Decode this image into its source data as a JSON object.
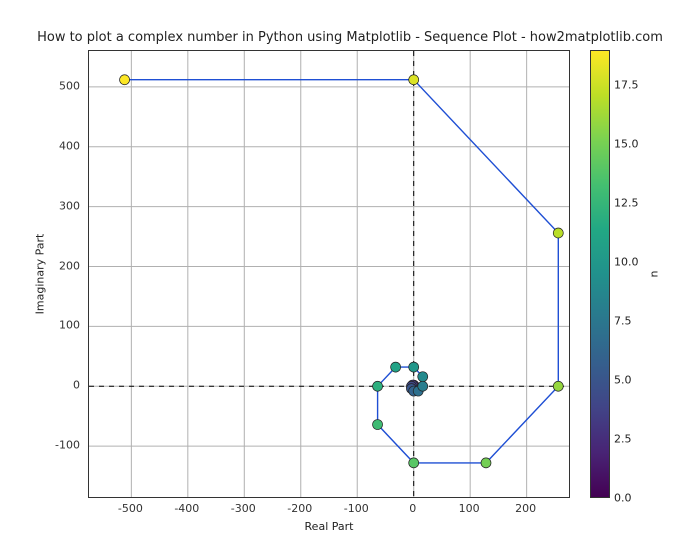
{
  "chart_data": {
    "type": "line",
    "title": "How to plot a complex number in Python using Matplotlib - Sequence Plot - how2matplotlib.com",
    "xlabel": "Real Part",
    "ylabel": "Imaginary Part",
    "xlim": [
      -575,
      275
    ],
    "ylim": [
      -185,
      560
    ],
    "xticks": [
      -500,
      -400,
      -300,
      -200,
      -100,
      0,
      100,
      200
    ],
    "yticks": [
      -100,
      0,
      100,
      200,
      300,
      400,
      500
    ],
    "x": [
      1,
      1,
      0,
      -2,
      -4,
      -4,
      0,
      8,
      16,
      16,
      0,
      -32,
      -64,
      -64,
      0,
      128,
      256,
      256,
      0,
      -512
    ],
    "y": [
      0,
      1,
      2,
      2,
      0,
      -4,
      -8,
      -8,
      0,
      16,
      32,
      32,
      0,
      -64,
      -128,
      -128,
      0,
      256,
      512,
      512
    ],
    "marker_n": [
      0,
      1,
      2,
      3,
      4,
      5,
      6,
      7,
      8,
      9,
      10,
      11,
      12,
      13,
      14,
      15,
      16,
      17,
      18,
      19
    ],
    "colorbar": {
      "label": "n",
      "min": 0,
      "max": 19,
      "ticks": [
        0.0,
        2.5,
        5.0,
        7.5,
        10.0,
        12.5,
        15.0,
        17.5
      ]
    }
  },
  "viridis_stops": [
    "#440154",
    "#482475",
    "#414487",
    "#355f8d",
    "#2a788e",
    "#21918c",
    "#22a884",
    "#44bf70",
    "#7ad151",
    "#bddf26",
    "#fde725"
  ]
}
